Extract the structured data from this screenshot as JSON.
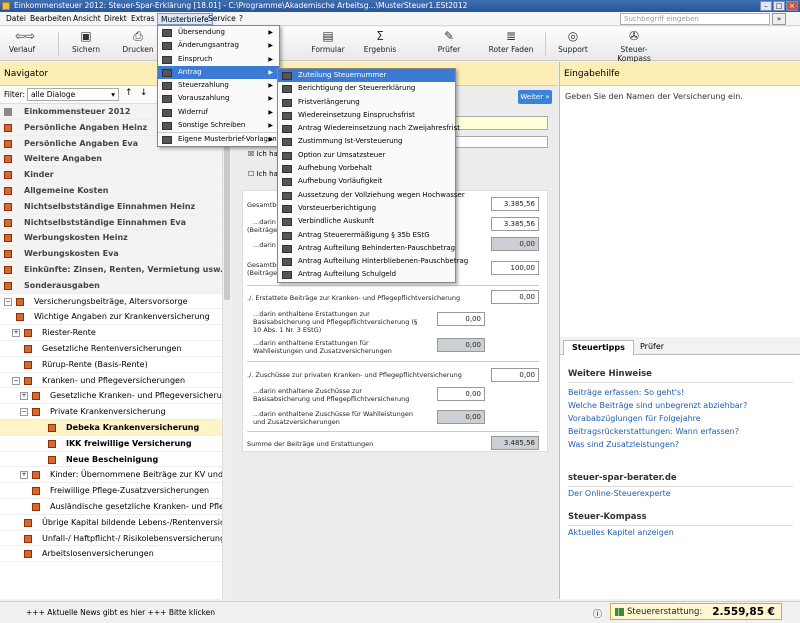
{
  "window": {
    "title": "Einkommensteuer 2012: Steuer-Spar-Erklärung [18.01] - C:\\Programme\\Akademische Arbeitsg...\\MusterSteuer1.ESt2012"
  },
  "menu": [
    "Datei",
    "Bearbeiten",
    "Ansicht",
    "Direkt",
    "Extras",
    "Musterbriefe",
    "Service",
    "?"
  ],
  "search": {
    "placeholder": "Suchbegriff eingeben"
  },
  "toolbar": {
    "verlauf": "Verlauf",
    "sichern": "Sichern",
    "drucken": "Drucken",
    "formular": "Formular",
    "ergebnis": "Ergebnis",
    "pruefer": "Prüfer",
    "roter_faden": "Roter Faden",
    "support": "Support",
    "kompass": "Steuer-Kompass"
  },
  "navigator": {
    "title": "Navigator",
    "filter_label": "Filter:",
    "filter_value": "alle Dialoge",
    "items": [
      {
        "label": "Einkommensteuer 2012",
        "kind": "cat"
      },
      {
        "label": "Persönliche Angaben Heinz",
        "kind": "cat"
      },
      {
        "label": "Persönliche Angaben Eva",
        "kind": "cat"
      },
      {
        "label": "Weitere Angaben",
        "kind": "cat"
      },
      {
        "label": "Kinder",
        "kind": "cat"
      },
      {
        "label": "Allgemeine Kosten",
        "kind": "cat"
      },
      {
        "label": "Nichtselbstständige Einnahmen Heinz",
        "kind": "cat"
      },
      {
        "label": "Nichtselbstständige Einnahmen Eva",
        "kind": "cat"
      },
      {
        "label": "Werbungskosten Heinz",
        "kind": "cat"
      },
      {
        "label": "Werbungskosten Eva",
        "kind": "cat"
      },
      {
        "label": "Einkünfte: Zinsen, Renten, Vermietung usw.",
        "kind": "cat"
      },
      {
        "label": "Sonderausgaben",
        "kind": "cat"
      },
      {
        "label": "Versicherungsbeiträge, Altersvorsorge",
        "kind": "node"
      },
      {
        "label": "Wichtige Angaben zur Krankenversicherung",
        "kind": "node"
      },
      {
        "label": "Riester-Rente",
        "kind": "node"
      },
      {
        "label": "Gesetzliche Rentenversicherungen",
        "kind": "node"
      },
      {
        "label": "Rürup-Rente (Basis-Rente)",
        "kind": "node"
      },
      {
        "label": "Kranken- und Pflegeversicherungen",
        "kind": "node"
      },
      {
        "label": "Gesetzliche Kranken- und Pflegeversicherung",
        "kind": "node"
      },
      {
        "label": "Private Krankenversicherung",
        "kind": "node"
      },
      {
        "label": "Debeka Krankenversicherung",
        "kind": "sel"
      },
      {
        "label": "IKK freiwillige Versicherung",
        "kind": "bold"
      },
      {
        "label": "Neue Bescheinigung",
        "kind": "bold"
      },
      {
        "label": "Kinder: Übernommene Beiträge zur KV und PV",
        "kind": "node"
      },
      {
        "label": "Freiwillige Pflege-Zusatzversicherungen",
        "kind": "node"
      },
      {
        "label": "Ausländische gesetzliche Kranken- und Pflege...",
        "kind": "node"
      },
      {
        "label": "Übrige Kapital bildende Lebens-/Rentenversicher...",
        "kind": "node"
      },
      {
        "label": "Unfall-/ Haftpflicht-/ Risikolebensversicherungen",
        "kind": "node"
      },
      {
        "label": "Arbeitslosenversicherungen",
        "kind": "node"
      }
    ]
  },
  "center": {
    "weiter": "Weiter »",
    "check1": "Ich ha",
    "check2": "Ich ha",
    "form": {
      "gesamt_label": "Gesamtbe",
      "gesamt_value": "3.385,56",
      "darin1_label": "...darin e",
      "darin1_sub": "(Beiträge",
      "darin1_value": "3.385,56",
      "darin2_label": "...darin e",
      "darin2_value": "0,00",
      "gesamt2_label": "Gesamtbe",
      "gesamt2_sub": "(Beiträge",
      "gesamt2_value": "100,00",
      "erstattete_label": "./. Erstattete Beiträge zur Kranken- und Pflegepflichtversicherung",
      "erstattete_value": "0,00",
      "basis_label": "...darin enthaltene Erstattungen zur Basisabsicherung und Pflegepflichtversicherung (§ 10 Abs. 1 Nr. 3 EStG)",
      "basis_value": "0,00",
      "wahl_label": "...darin enthaltene Erstattungen für Wahlleistungen und Zusatzversicherungen",
      "wahl_value": "0,00",
      "zuschuesse_label": "./. Zuschüsse zur privaten Kranken- und Pflegepflichtversicherung",
      "zuschuesse_value": "0,00",
      "zbasis_label": "...darin enthaltene Zuschüsse zur Basisabsicherung und Pflegepflichtversicherung",
      "zbasis_value": "0,00",
      "zwahl_label": "...darin enthaltene Zuschüsse für Wahlleistungen und Zusatzversicherungen",
      "zwahl_value": "0,00",
      "summe_label": "Summe der Beiträge und Erstattungen",
      "summe_value": "3.485,56"
    }
  },
  "right": {
    "title": "Eingabehilfe",
    "help": "Geben Sie den Namen der Versicherung ein.",
    "tab1": "Steuertipps",
    "tab2": "Prüfer",
    "weitere": "Weitere Hinweise",
    "links": [
      "Beiträge erfassen: So geht's!",
      "Welche Beiträge sind unbegrenzt abziehbar?",
      "Vorababzüglungen für Folgejahre",
      "Beitragsrückerstattungen: Wann erfassen?",
      "Was sind Zusatzleistungen?"
    ],
    "berater": "steuer-spar-berater.de",
    "berater_link": "Der Online-Steuerexperte",
    "kompass": "Steuer-Kompass",
    "kompass_link": "Aktuelles Kapitel anzeigen"
  },
  "status": {
    "news": "+++ Aktuelle News gibt es hier +++ Bitte klicken",
    "refund_label": "Steuererstattung:",
    "refund_value": "2.559,85 €"
  },
  "menu_musterbriefe": [
    "Übersendung",
    "Änderungsantrag",
    "Einspruch",
    "Antrag",
    "Steuerzahlung",
    "Vorauszahlung",
    "Widerruf",
    "Sonstige Schreiben",
    "Eigene Musterbrief-Vorlagen"
  ],
  "submenu_antrag": [
    "Zuteilung Steuernummer",
    "Berichtigung der Steuererklärung",
    "Fristverlängerung",
    "Wiedereinsetzung Einspruchsfrist",
    "Antrag Wiedereinsetzung nach Zweijahresfrist",
    "Zustimmung Ist-Versteuerung",
    "Option zur Umsatzsteuer",
    "Aufhebung Vorbehalt",
    "Aufhebung Vorläufigkeit",
    "Aussetzung der Vollziehung wegen Hochwasser",
    "Vorsteuerberichtigung",
    "Verbindliche Auskunft",
    "Antrag Steuerermäßigung § 35b EStG",
    "Antrag Aufteilung Behinderten-Pauschbetrag",
    "Antrag Aufteilung Hinterbliebenen-Pauschbetrag",
    "Antrag Aufteilung Schulgeld"
  ]
}
